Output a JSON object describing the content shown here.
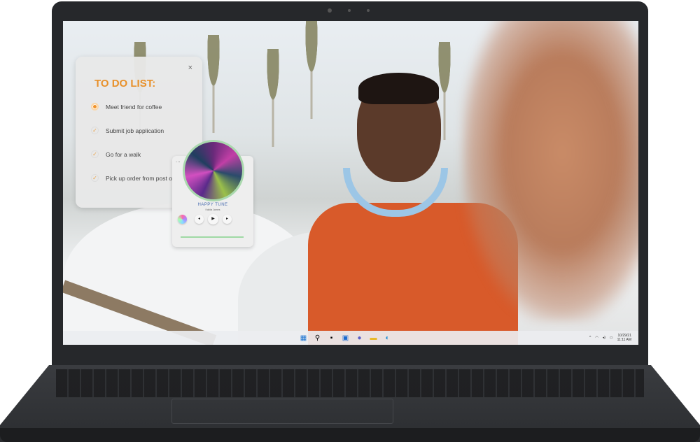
{
  "todo": {
    "title": "TO DO LIST:",
    "close": "×",
    "items": [
      {
        "label": "Meet friend for coffee",
        "state": "active"
      },
      {
        "label": "Submit job application",
        "state": "done"
      },
      {
        "label": "Go for a walk",
        "state": "done"
      },
      {
        "label": "Pick up order from post o",
        "state": "done"
      }
    ]
  },
  "music": {
    "menu": "...",
    "title": "HAPPY TUNE",
    "artist": "Kalida James",
    "prev": "◂",
    "play": "▶",
    "next": "▸"
  },
  "taskbar": {
    "date": "10/29/21",
    "time": "11:11 AM",
    "chevron": "^"
  },
  "colors": {
    "accent": "#e8902a",
    "music_title": "#4a6db0"
  }
}
